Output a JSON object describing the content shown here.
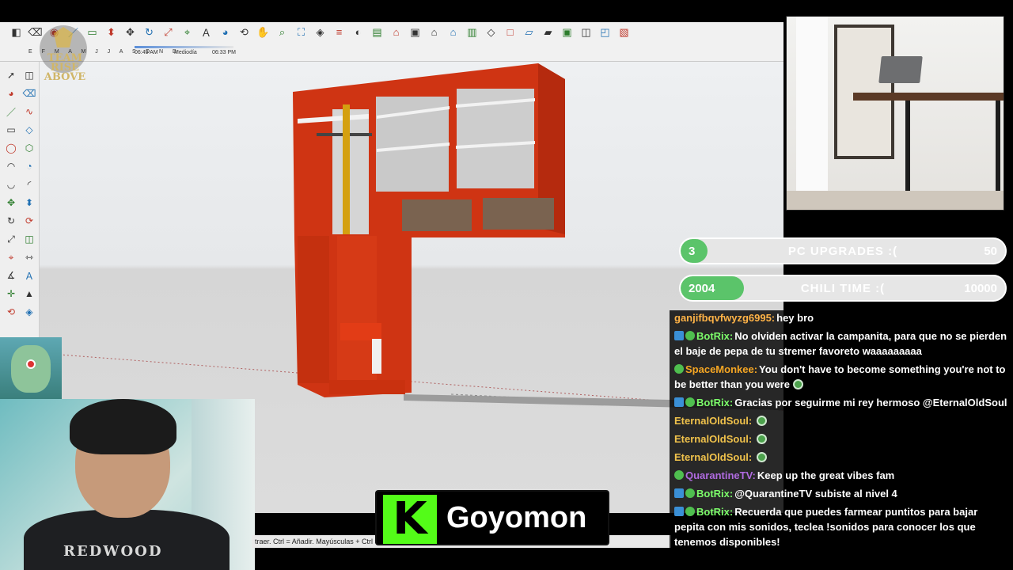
{
  "toolbar": {
    "timeline": {
      "months": "E F M A M J J A S O N D",
      "sunrise": "06:49 AM",
      "midday": "Mediodía",
      "sunset": "06:33 PM"
    },
    "top_icons": [
      "select-icon",
      "eraser-icon",
      "paint-icon",
      "line-icon",
      "rectangle-icon",
      "push-pull-icon",
      "move-icon",
      "rotate-icon",
      "scale-icon",
      "tape-icon",
      "text-icon",
      "paint-bucket-icon",
      "orbit-icon",
      "pan-icon",
      "zoom-icon",
      "zoom-extents-icon",
      "section-icon",
      "layers-icon",
      "styles-icon",
      "scenes-icon",
      "camera-icon",
      "component-icon",
      "house-icon",
      "home-icon",
      "warehouse-icon",
      "view-iso-icon",
      "view-top-icon",
      "view-front-icon",
      "view-right-icon",
      "view-back-icon",
      "view-left-icon",
      "xray-icon",
      "wireframe-icon"
    ]
  },
  "logo_text": "TEAM RISE ABOVE",
  "status_bar": "traer. Ctrl = Añadir. Mayúsculas + Ctrl =",
  "goals": [
    {
      "current": "3",
      "title": "PC UPGRADES :(",
      "max": "50",
      "progress": 0.06
    },
    {
      "current": "2004",
      "title": "CHILI TIME :(",
      "max": "10000",
      "progress": 0.2
    }
  ],
  "chat": {
    "messages": [
      {
        "user": "ganjifbqvfwyzg6995:",
        "color": "#ffb347",
        "text": "hey bro",
        "badges": []
      },
      {
        "user": "BotRix:",
        "color": "#7cfc6a",
        "text": "No olviden activar la campanita, para que no se pierden el baje de pepa de tu stremer favoreto waaaaaaaaa",
        "badges": [
          "blue",
          "green"
        ]
      },
      {
        "user": "SpaceMonkee:",
        "color": "#f5a623",
        "text": "You don't have to become something you're not to be better than you were",
        "badges": [
          "green"
        ],
        "emote": true
      },
      {
        "user": "BotRix:",
        "color": "#7cfc6a",
        "text": "Gracias por seguirme mi rey hermoso @EternalOldSoul",
        "badges": [
          "blue",
          "green"
        ]
      },
      {
        "user": "EternalOldSoul:",
        "color": "#f0c24b",
        "text": "",
        "badges": [],
        "emote": true
      },
      {
        "user": "EternalOldSoul:",
        "color": "#f0c24b",
        "text": "",
        "badges": [],
        "emote": true
      },
      {
        "user": "EternalOldSoul:",
        "color": "#f0c24b",
        "text": "",
        "badges": [],
        "emote": true
      },
      {
        "user": "QuarantineTV:",
        "color": "#b06be0",
        "text": "Keep up the great vibes fam",
        "badges": [
          "green"
        ]
      },
      {
        "user": "BotRix:",
        "color": "#7cfc6a",
        "text": "@QuarantineTV subiste al nivel 4",
        "badges": [
          "blue",
          "green"
        ]
      },
      {
        "user": "BotRix:",
        "color": "#7cfc6a",
        "text": "Recuerda que puedes farmear puntitos para bajar pepita con mis sonidos, teclea !sonidos para conocer los que tenemos disponibles!",
        "badges": [
          "blue",
          "green"
        ]
      }
    ]
  },
  "streamer": {
    "platform_letter": "K",
    "name": "Goyomon"
  },
  "webcam": {
    "shirt_text": "REDWOOD"
  },
  "colors": {
    "cabinet": "#d63a16",
    "kick_green": "#53fc18",
    "goal_fill": "#5bc46a"
  }
}
